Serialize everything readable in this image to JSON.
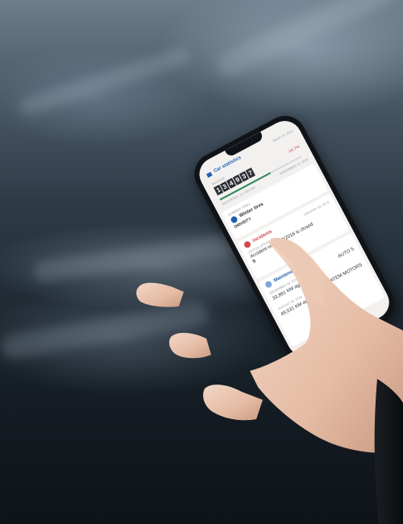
{
  "app": {
    "header": "Car statistics",
    "date_top": "March 14, 2019",
    "change": "-16.7%",
    "mileage_label": "MILEAGE",
    "odometer_digits": [
      "1",
      "3",
      "4",
      "9",
      "3",
      "7"
    ],
    "mileage_progress": 0.62,
    "reported_label": "REPORTED: 117 583 KM",
    "reported_date": "NOVEMBER 15, 2018"
  },
  "tires": {
    "section_label": "SUMMER TIRES",
    "title": "Winter tires",
    "brand": "DRIVEITY"
  },
  "incidents": {
    "title": "Incidents",
    "date": "JANUARY 18, 2019",
    "status_label": "STATUS UPDATED",
    "headline": "Accident on 11/03/2016 is closed",
    "count": "9"
  },
  "maintenance": {
    "title": "Maintenance",
    "date_1": "DECEMBER 18, 2018",
    "dealer_1": "AUTO 5",
    "km_1": "33,891 KM ago",
    "date_2": "AUGUST 28, 2018",
    "dealer_2": "LATEM MOTORS",
    "km_2": "49,531 KM ago"
  },
  "colors": {
    "accent_blue": "#1f5fae",
    "incident_red": "#d64545",
    "progress_green": "#2e8b57"
  }
}
